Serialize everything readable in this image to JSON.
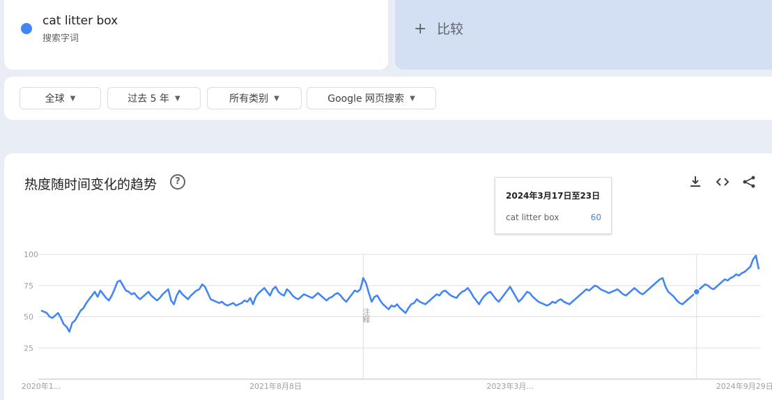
{
  "search_term": {
    "name": "cat litter box",
    "type_label": "搜索字词",
    "color": "#4285f4"
  },
  "compare": {
    "plus": "+",
    "label": "比较"
  },
  "filters": [
    {
      "label": "全球"
    },
    {
      "label": "过去 5 年"
    },
    {
      "label": "所有类别"
    },
    {
      "label": "Google 网页搜索"
    }
  ],
  "chart_section": {
    "title": "热度随时间变化的趋势",
    "help_icon": "help-circle-icon",
    "actions": [
      "download-icon",
      "embed-code-icon",
      "share-icon"
    ],
    "marker_note": "注释"
  },
  "tooltip": {
    "title": "2024年3月17日至23日",
    "term": "cat litter box",
    "value": "60"
  },
  "chart_data": {
    "type": "line",
    "title": "",
    "xlabel": "",
    "ylabel": "",
    "ylim": [
      0,
      100
    ],
    "yticks": [
      25,
      50,
      75,
      100
    ],
    "xtick_labels": [
      "2020年1...",
      "2021年8月8日",
      "2023年3月...",
      "2024年9月29日"
    ],
    "xtick_index": [
      0,
      83,
      166,
      249
    ],
    "note_line_index": 114,
    "hover_index": 232,
    "grid": true,
    "series": [
      {
        "name": "cat litter box",
        "color": "#4285f4",
        "values": [
          55,
          54,
          53,
          50,
          49,
          51,
          53,
          49,
          44,
          42,
          38,
          45,
          47,
          51,
          55,
          57,
          61,
          64,
          67,
          70,
          66,
          71,
          68,
          65,
          63,
          67,
          72,
          78,
          79,
          75,
          71,
          70,
          68,
          69,
          66,
          64,
          66,
          68,
          70,
          67,
          65,
          63,
          65,
          68,
          70,
          72,
          63,
          60,
          67,
          71,
          68,
          66,
          64,
          67,
          69,
          71,
          72,
          76,
          74,
          69,
          64,
          63,
          62,
          61,
          62,
          60,
          59,
          60,
          61,
          59,
          60,
          61,
          63,
          62,
          65,
          60,
          66,
          69,
          71,
          73,
          70,
          67,
          72,
          74,
          70,
          68,
          67,
          72,
          70,
          67,
          65,
          64,
          66,
          68,
          67,
          66,
          65,
          67,
          69,
          67,
          65,
          63,
          65,
          66,
          68,
          69,
          67,
          64,
          62,
          65,
          68,
          71,
          70,
          72,
          81,
          77,
          69,
          62,
          66,
          67,
          63,
          60,
          58,
          56,
          59,
          58,
          60,
          57,
          55,
          53,
          57,
          60,
          61,
          64,
          62,
          61,
          60,
          62,
          64,
          66,
          68,
          67,
          70,
          71,
          69,
          67,
          66,
          65,
          68,
          70,
          71,
          73,
          70,
          66,
          63,
          60,
          64,
          67,
          69,
          70,
          67,
          64,
          62,
          65,
          68,
          71,
          74,
          70,
          66,
          62,
          64,
          67,
          70,
          69,
          66,
          64,
          62,
          61,
          60,
          59,
          60,
          62,
          61,
          63,
          64,
          62,
          61,
          60,
          62,
          64,
          66,
          68,
          70,
          72,
          71,
          73,
          75,
          74,
          72,
          71,
          70,
          69,
          70,
          71,
          72,
          70,
          68,
          67,
          69,
          71,
          73,
          71,
          69,
          68,
          70,
          72,
          74,
          76,
          78,
          80,
          81,
          74,
          70,
          68,
          66,
          63,
          61,
          60,
          62,
          64,
          66,
          68,
          70,
          72,
          74,
          76,
          75,
          73,
          72,
          74,
          76,
          78,
          80,
          79,
          81,
          82,
          84,
          83,
          85,
          86,
          88,
          90,
          96,
          99,
          88
        ]
      }
    ]
  }
}
